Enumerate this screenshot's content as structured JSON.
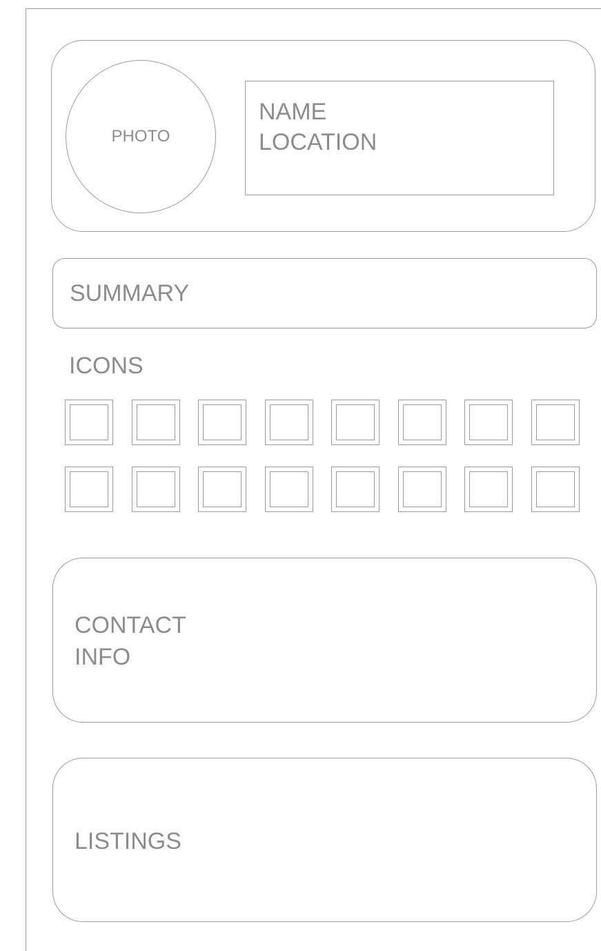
{
  "header": {
    "photo_label": "PHOTO",
    "name_label": "NAME",
    "location_label": "LOCATION"
  },
  "summary": {
    "label": "SUMMARY"
  },
  "icons": {
    "label": "ICONS",
    "rows": 2,
    "per_row": 8
  },
  "contact": {
    "line1": "CONTACT",
    "line2": "INFO"
  },
  "listings": {
    "label": "LISTINGS"
  },
  "colors": {
    "stroke": "#9a9a9a",
    "text": "#8c8c8c",
    "background": "#ffffff"
  }
}
